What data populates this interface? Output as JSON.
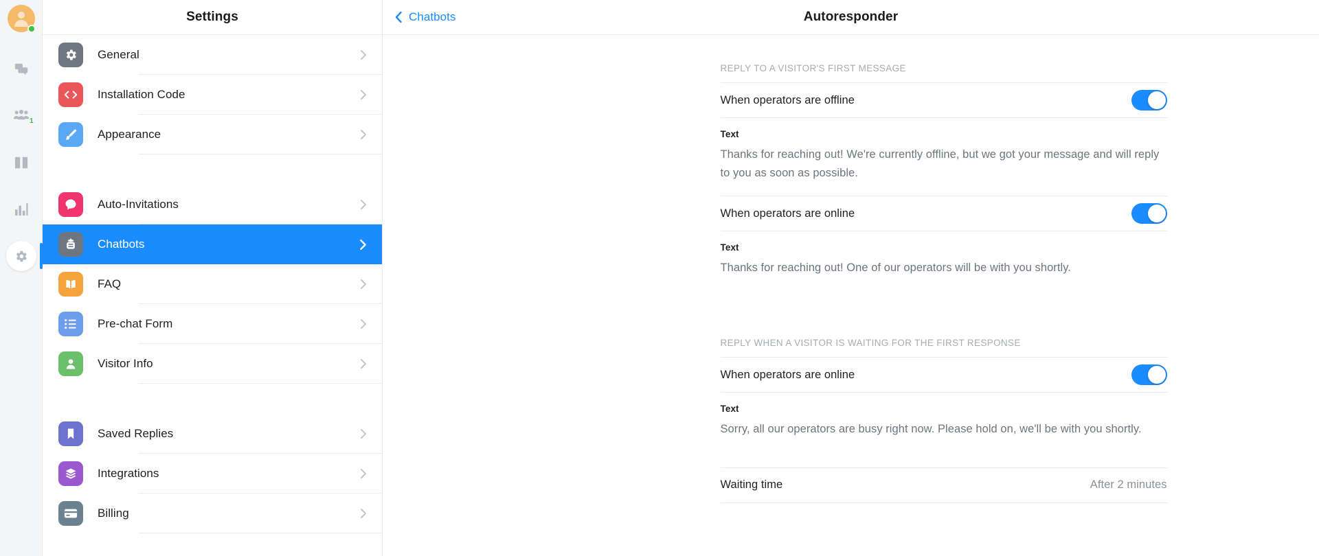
{
  "rail": {
    "avatar": {
      "status": "online"
    },
    "items": [
      {
        "icon": "chats-icon",
        "name": "rail-item-chats",
        "badge": ""
      },
      {
        "icon": "visitors-icon",
        "name": "rail-item-visitors",
        "badge": "1"
      },
      {
        "icon": "knowledge-base-icon",
        "name": "rail-item-knowledge-base",
        "badge": ""
      },
      {
        "icon": "reports-icon",
        "name": "rail-item-reports",
        "badge": ""
      },
      {
        "icon": "gear-icon",
        "name": "rail-item-settings",
        "badge": "",
        "active": true
      }
    ]
  },
  "settings": {
    "title": "Settings",
    "groups": [
      {
        "items": [
          {
            "label": "General",
            "icon": "gear-icon",
            "color": "#6e7681",
            "selected": false
          },
          {
            "label": "Installation Code",
            "icon": "code-icon",
            "color": "#e9575a",
            "selected": false
          },
          {
            "label": "Appearance",
            "icon": "brush-icon",
            "color": "#5aa7f5",
            "selected": false
          }
        ]
      },
      {
        "items": [
          {
            "label": "Auto-Invitations",
            "icon": "chat-bubble-icon",
            "color": "#f0356e",
            "selected": false
          },
          {
            "label": "Chatbots",
            "icon": "robot-icon",
            "color": "#6e7681",
            "selected": true
          },
          {
            "label": "FAQ",
            "icon": "book-icon",
            "color": "#f5a33c",
            "selected": false
          },
          {
            "label": "Pre-chat Form",
            "icon": "list-icon",
            "color": "#6d9eeb",
            "selected": false
          },
          {
            "label": "Visitor Info",
            "icon": "person-icon",
            "color": "#6bc06b",
            "selected": false
          }
        ]
      },
      {
        "items": [
          {
            "label": "Saved Replies",
            "icon": "bookmark-icon",
            "color": "#6e72cf",
            "selected": false
          },
          {
            "label": "Integrations",
            "icon": "layers-icon",
            "color": "#9b59d0",
            "selected": false
          },
          {
            "label": "Billing",
            "icon": "card-icon",
            "color": "#6b818f",
            "selected": false
          }
        ]
      }
    ]
  },
  "main": {
    "back_label": "Chatbots",
    "title": "Autoresponder",
    "sections": [
      {
        "heading": "REPLY TO A VISITOR'S FIRST MESSAGE",
        "rows": [
          {
            "label": "When operators are offline",
            "toggle": "on",
            "text_label": "Text",
            "text_value": "Thanks for reaching out! We're currently offline, but we got your message and will reply to you as soon as possible."
          },
          {
            "label": "When operators are online",
            "toggle": "on",
            "text_label": "Text",
            "text_value": "Thanks for reaching out! One of our operators will be with you shortly."
          }
        ]
      },
      {
        "heading": "REPLY WHEN A VISITOR IS WAITING FOR THE FIRST RESPONSE",
        "rows": [
          {
            "label": "When operators are online",
            "toggle": "on",
            "text_label": "Text",
            "text_value": "Sorry, all our operators are busy right now. Please hold on, we'll be with you shortly."
          }
        ],
        "value_row": {
          "label": "Waiting time",
          "value": "After 2 minutes"
        }
      }
    ]
  },
  "colors": {
    "accent": "#1a8cff",
    "muted": "#a7abb2",
    "text": "#1f1f1f",
    "subtext": "#6e747d"
  }
}
